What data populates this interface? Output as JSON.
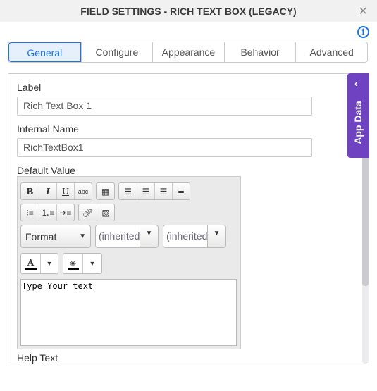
{
  "title": "FIELD SETTINGS - RICH TEXT BOX (LEGACY)",
  "close_icon": "×",
  "tabs": [
    "General",
    "Configure",
    "Appearance",
    "Behavior",
    "Advanced"
  ],
  "active_tab": "General",
  "fields": {
    "label": {
      "label": "Label",
      "value": "Rich Text Box 1"
    },
    "internal_name": {
      "label": "Internal Name",
      "value": "RichTextBox1"
    },
    "default_value": {
      "label": "Default Value",
      "format": "Format",
      "font": "(inherited",
      "size": "(inherited",
      "text": "Type Your text"
    },
    "help_text": {
      "label": "Help Text"
    }
  },
  "app_data": "App Data",
  "accent": "#1a73e8",
  "app_data_color": "#6f42c1"
}
